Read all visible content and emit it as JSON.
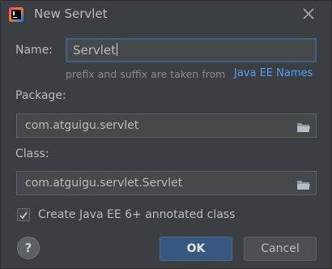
{
  "dialog": {
    "title": "New Servlet",
    "icon": "intellij-idea-icon",
    "close_icon": "close-icon"
  },
  "name": {
    "label": "Name:",
    "value": "Servlet"
  },
  "hint": {
    "text": "prefix and suffix are taken from",
    "link": "Java EE Names"
  },
  "package": {
    "label": "Package:",
    "value": "com.atguigu.servlet",
    "browse_icon": "folder-icon"
  },
  "class": {
    "label": "Class:",
    "value": "com.atguigu.servlet.Servlet",
    "browse_icon": "folder-icon"
  },
  "annotated": {
    "checked": true,
    "label": "Create Java EE 6+ annotated class"
  },
  "footer": {
    "help_label": "?",
    "ok_label": "OK",
    "cancel_label": "Cancel"
  },
  "colors": {
    "background": "#3c3f41",
    "field_background": "#45494a",
    "focus_border": "#3d6185",
    "link": "#589df6",
    "primary_button": "#365880"
  }
}
